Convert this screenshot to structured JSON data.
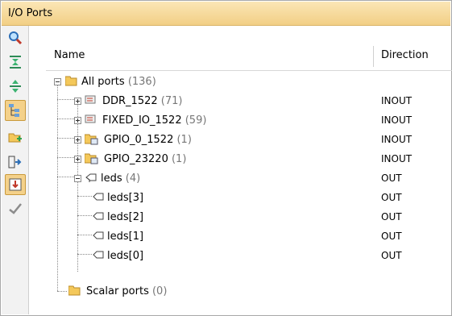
{
  "panel": {
    "title": "I/O Ports"
  },
  "toolbar": {
    "buttons": [
      {
        "icon": "search-icon"
      },
      {
        "icon": "collapse-all-icon"
      },
      {
        "icon": "expand-all-icon"
      },
      {
        "icon": "group-by-interface-icon",
        "active": true
      },
      {
        "icon": "create-port-icon"
      },
      {
        "icon": "place-port-icon"
      },
      {
        "icon": "auto-place-icon",
        "active": true
      },
      {
        "icon": "checkmark-icon"
      }
    ]
  },
  "columns": {
    "name": "Name",
    "direction": "Direction"
  },
  "tree": [
    {
      "label": "All ports",
      "count": "(136)",
      "direction": ""
    },
    {
      "label": "DDR_1522",
      "count": "(71)",
      "direction": "INOUT"
    },
    {
      "label": "FIXED_IO_1522",
      "count": "(59)",
      "direction": "INOUT"
    },
    {
      "label": "GPIO_0_1522",
      "count": "(1)",
      "direction": "INOUT"
    },
    {
      "label": "GPIO_23220",
      "count": "(1)",
      "direction": "INOUT"
    },
    {
      "label": "leds",
      "count": "(4)",
      "direction": "OUT"
    },
    {
      "label": "leds[3]",
      "count": "",
      "direction": "OUT"
    },
    {
      "label": "leds[2]",
      "count": "",
      "direction": "OUT"
    },
    {
      "label": "leds[1]",
      "count": "",
      "direction": "OUT"
    },
    {
      "label": "leds[0]",
      "count": "",
      "direction": "OUT"
    },
    {
      "label": "Scalar ports",
      "count": "(0)",
      "direction": ""
    }
  ],
  "colors": {
    "title_bg": "#f2cf85",
    "active_button": "#f4d18a",
    "folder": "#f4c85a"
  }
}
